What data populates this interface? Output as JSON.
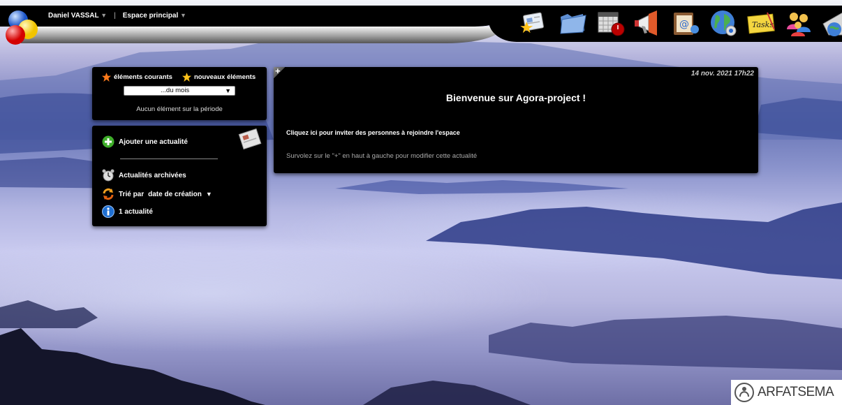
{
  "topbar": {
    "user_name": "Daniel VASSAL",
    "space_name": "Espace principal",
    "apps": [
      "newspaper-icon",
      "folder-icon",
      "calendar-icon",
      "megaphone-icon",
      "contacts-icon",
      "globe-icon",
      "tasks-icon",
      "users-icon",
      "mail-icon"
    ],
    "tasks_label": "Tasks"
  },
  "period_panel": {
    "current_label": "éléments courants",
    "new_label": "nouveaux éléments",
    "period_selected": "...du mois",
    "empty_text": "Aucun élément sur la période"
  },
  "news_menu": {
    "add_label": "Ajouter une actualité",
    "archived_label": "Actualités archivées",
    "sort_prefix": "Trié par",
    "sort_value": "date de création",
    "count_label": "1 actualité"
  },
  "news_item": {
    "date": "14 nov. 2021 17h22",
    "title": "Bienvenue sur Agora-project !",
    "invite_text": "Cliquez ici pour inviter des personnes à rejoindre l'espace",
    "hint_text": "Survolez sur le \"+\" en haut à gauche pour modifier cette actualité",
    "plus": "+"
  },
  "brand": {
    "name": "ARFATSEMA"
  },
  "colors": {
    "accent_star_orange": "#ff7a1a",
    "accent_star_yellow": "#ffc21a",
    "add_green": "#3fae2a",
    "info_blue": "#1f6fd1"
  }
}
